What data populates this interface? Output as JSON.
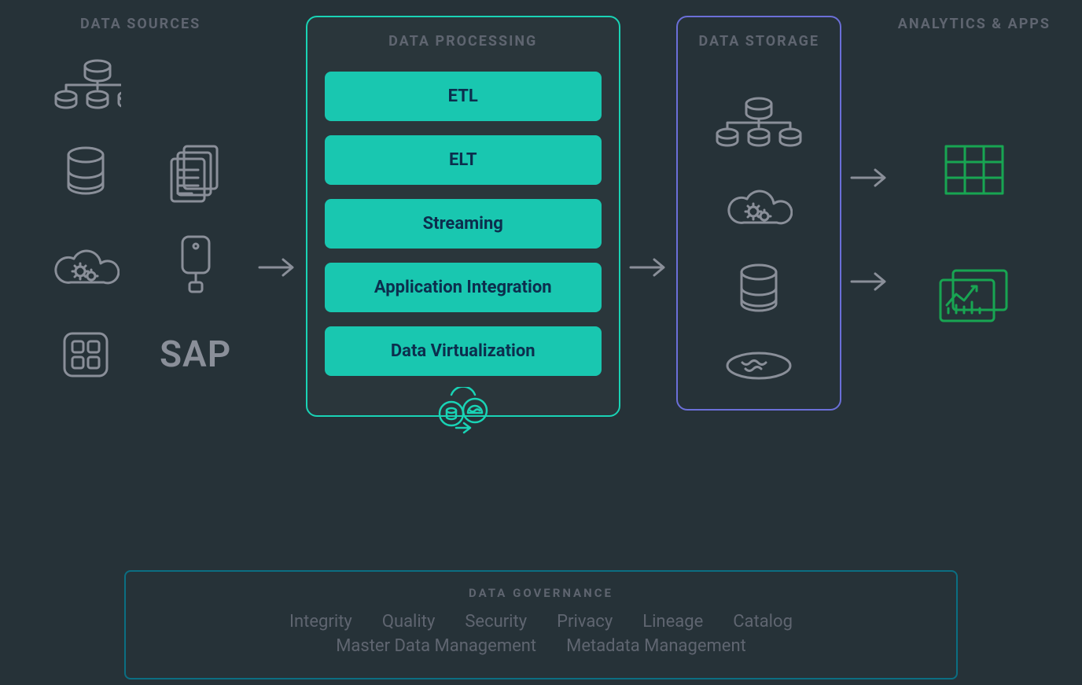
{
  "columns": {
    "sources": {
      "title": "DATA SOURCES"
    },
    "processing": {
      "title": "DATA PROCESSING",
      "items": [
        "ETL",
        "ELT",
        "Streaming",
        "Application Integration",
        "Data Virtualization"
      ]
    },
    "storage": {
      "title": "DATA STORAGE"
    },
    "analytics": {
      "title": "ANALYTICS & APPS"
    }
  },
  "source_labels": {
    "sap": "SAP"
  },
  "governance": {
    "title": "DATA GOVERNANCE",
    "row1": [
      "Integrity",
      "Quality",
      "Security",
      "Privacy",
      "Lineage",
      "Catalog"
    ],
    "row2": [
      "Master Data Management",
      "Metadata Management"
    ]
  },
  "colors": {
    "teal": "#19c7b0",
    "teal_border": "#19d3b5",
    "purple": "#6b6fd8",
    "icon_gray": "#8a8f99",
    "analytics_green": "#18a552",
    "gov_border": "#0b6e82"
  }
}
